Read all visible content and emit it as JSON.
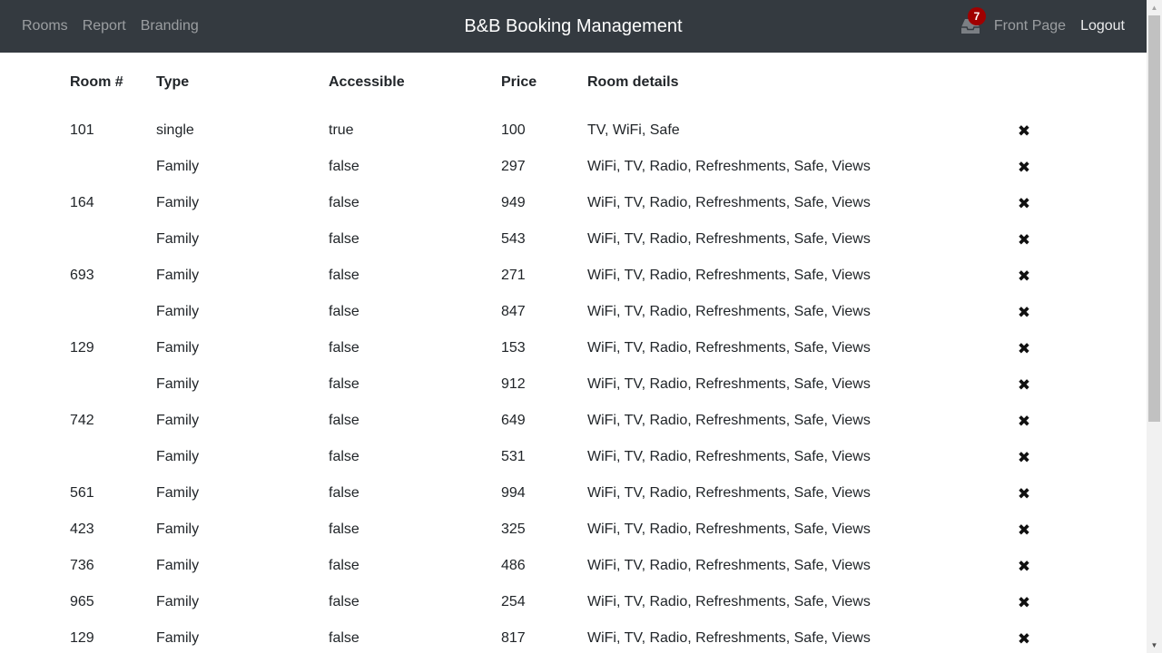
{
  "nav": {
    "links": [
      "Rooms",
      "Report",
      "Branding"
    ],
    "brand": "B&B Booking Management",
    "notification_count": "7",
    "front_page": "Front Page",
    "logout": "Logout"
  },
  "table": {
    "headers": [
      "Room #",
      "Type",
      "Accessible",
      "Price",
      "Room details"
    ],
    "rows": [
      {
        "room": "101",
        "type": "single",
        "accessible": "true",
        "price": "100",
        "details": "TV, WiFi, Safe"
      },
      {
        "room": "",
        "type": "Family",
        "accessible": "false",
        "price": "297",
        "details": "WiFi, TV, Radio, Refreshments, Safe, Views"
      },
      {
        "room": "164",
        "type": "Family",
        "accessible": "false",
        "price": "949",
        "details": "WiFi, TV, Radio, Refreshments, Safe, Views"
      },
      {
        "room": "",
        "type": "Family",
        "accessible": "false",
        "price": "543",
        "details": "WiFi, TV, Radio, Refreshments, Safe, Views"
      },
      {
        "room": "693",
        "type": "Family",
        "accessible": "false",
        "price": "271",
        "details": "WiFi, TV, Radio, Refreshments, Safe, Views"
      },
      {
        "room": "",
        "type": "Family",
        "accessible": "false",
        "price": "847",
        "details": "WiFi, TV, Radio, Refreshments, Safe, Views"
      },
      {
        "room": "129",
        "type": "Family",
        "accessible": "false",
        "price": "153",
        "details": "WiFi, TV, Radio, Refreshments, Safe, Views"
      },
      {
        "room": "",
        "type": "Family",
        "accessible": "false",
        "price": "912",
        "details": "WiFi, TV, Radio, Refreshments, Safe, Views"
      },
      {
        "room": "742",
        "type": "Family",
        "accessible": "false",
        "price": "649",
        "details": "WiFi, TV, Radio, Refreshments, Safe, Views"
      },
      {
        "room": "",
        "type": "Family",
        "accessible": "false",
        "price": "531",
        "details": "WiFi, TV, Radio, Refreshments, Safe, Views"
      },
      {
        "room": "561",
        "type": "Family",
        "accessible": "false",
        "price": "994",
        "details": "WiFi, TV, Radio, Refreshments, Safe, Views"
      },
      {
        "room": "423",
        "type": "Family",
        "accessible": "false",
        "price": "325",
        "details": "WiFi, TV, Radio, Refreshments, Safe, Views"
      },
      {
        "room": "736",
        "type": "Family",
        "accessible": "false",
        "price": "486",
        "details": "WiFi, TV, Radio, Refreshments, Safe, Views"
      },
      {
        "room": "965",
        "type": "Family",
        "accessible": "false",
        "price": "254",
        "details": "WiFi, TV, Radio, Refreshments, Safe, Views"
      },
      {
        "room": "129",
        "type": "Family",
        "accessible": "false",
        "price": "817",
        "details": "WiFi, TV, Radio, Refreshments, Safe, Views"
      }
    ],
    "delete_icon": "close-icon"
  },
  "colors": {
    "navbar_bg": "#343a40",
    "badge_bg": "#a00000",
    "text": "#212529"
  }
}
